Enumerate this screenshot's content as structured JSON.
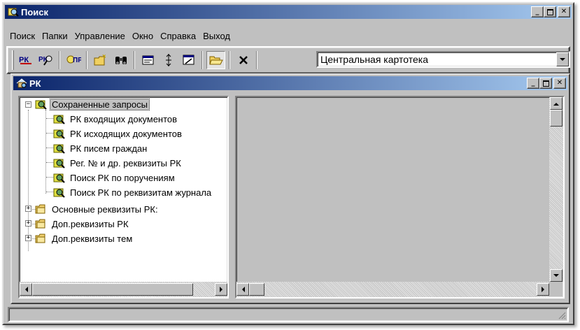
{
  "window": {
    "title": "Поиск",
    "caption_buttons": [
      "minimize-icon",
      "maximize-icon",
      "close-icon"
    ]
  },
  "menu": {
    "items": [
      "Поиск",
      "Папки",
      "Управление",
      "Окно",
      "Справка",
      "Выход"
    ]
  },
  "toolbar": {
    "buttons": [
      "rk-search-icon",
      "rk-settings-icon",
      "poruchenie-icon",
      "new-folder-icon",
      "binoculars-icon",
      "form-icon",
      "sort-icon",
      "edit-form-icon",
      "open-folder-icon",
      "delete-icon"
    ],
    "rk_label": "РК",
    "pr_label": "ПР"
  },
  "cabinet_combo": {
    "value": "Центральная картотека"
  },
  "child_window": {
    "title": "РК"
  },
  "tree": {
    "root_saved": "Сохраненные запросы",
    "saved_queries": [
      "РК входящих документов",
      "РК исходящих документов",
      "РК писем граждан",
      "Рег. № и др. реквизиты РК",
      "Поиск РК по поручениям",
      "Поиск РК по реквизитам журнала"
    ],
    "folders": [
      "Основные реквизиты РК:",
      "Доп.реквизиты РК",
      "Доп.реквизиты тем"
    ]
  },
  "colors": {
    "titlebar_start": "#0a246a",
    "titlebar_end": "#a6caf0",
    "face": "#c0c0c0"
  }
}
